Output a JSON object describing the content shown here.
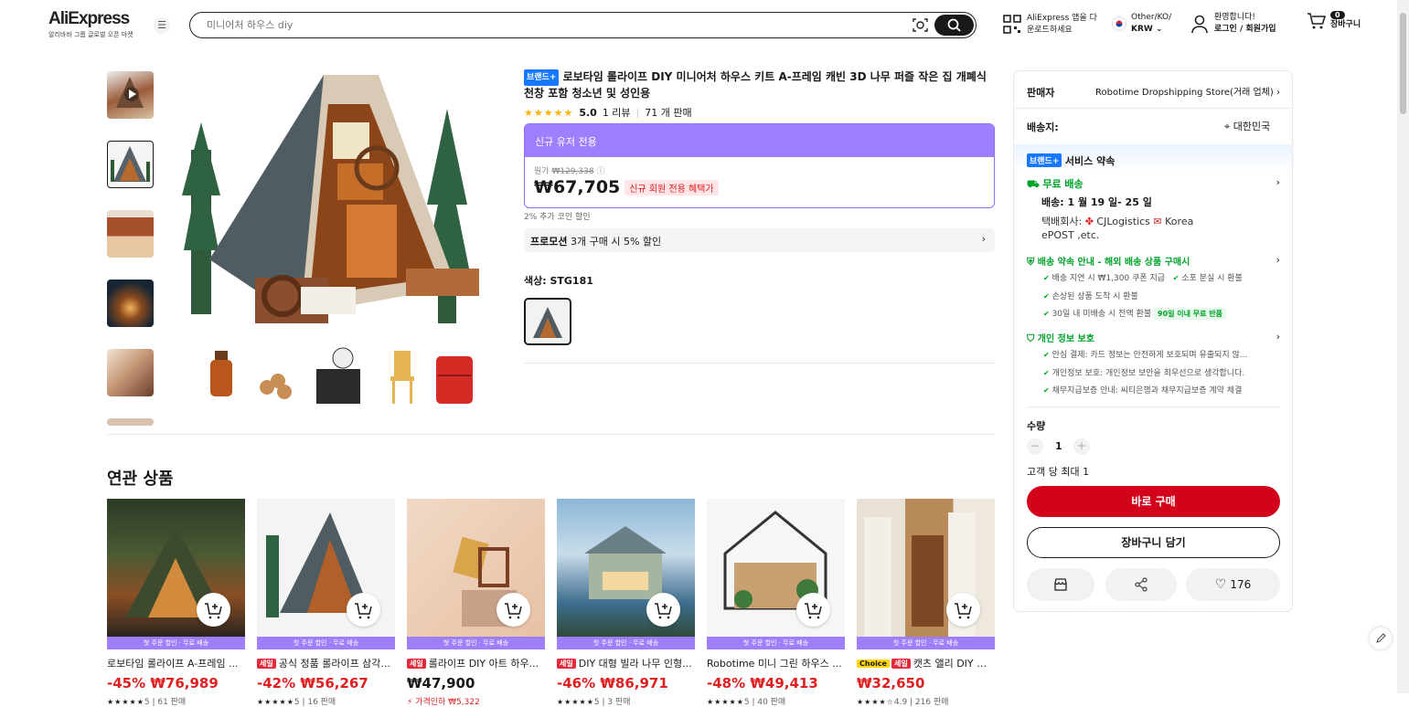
{
  "header": {
    "logo": "AliExpress",
    "logo_tagline": "알리바바 그룹 글로벌 오픈 마켓",
    "search_placeholder": "미니어처 하우스 diy",
    "app_line1": "AliExpress 앱을 다",
    "app_line2": "운로드하세요",
    "lang_line1": "Other/KO/",
    "lang_line2": "KRW",
    "user_line1": "환영합니다!",
    "user_line2": "로그인 / 회원가입",
    "cart_count": "0",
    "cart_label": "장바구니"
  },
  "product": {
    "brand_badge": "브랜드+",
    "title": "로보타임 롤라이프 DIY 미니어처 하우스 키트 A-프레임 캐빈 3D 나무 퍼즐 작은 집 개폐식 천창 포함 청소년 및 성인용",
    "rating": "5.0",
    "reviews": "1 리뷰",
    "sold": "71 개 판매",
    "price_header": "신규 유저 전용",
    "orig_label": "원가",
    "orig_price": "₩129,338",
    "price": "₩67,705",
    "price_badge": "신규 회원 전용 혜택가",
    "coin_note": "2% 추가 코인 할인",
    "promo_label": "프로모션",
    "promo_text": "3개 구매 시 5% 할인",
    "color_label": "색상: STG181"
  },
  "related": {
    "heading": "연관 상품",
    "strip": "첫 주문 할인 · 무료 배송",
    "items": [
      {
        "title": "로보타임 롤라이프 A-프레임 ...",
        "badge": "",
        "choice": "",
        "discount": "-45%",
        "price": "₩76,989",
        "meta": "5 | 61 판매"
      },
      {
        "title": "공식 정품 롤라이프 삼각...",
        "badge": "세일",
        "choice": "",
        "discount": "-42%",
        "price": "₩56,267",
        "meta": "5 | 16 판매"
      },
      {
        "title": "롤라이프 DIY 아트 하우...",
        "badge": "세일",
        "choice": "",
        "discount": "",
        "price": "₩47,900",
        "meta": "가격인하 ₩5,322"
      },
      {
        "title": "DIY 대형 빌라 나무 인형...",
        "badge": "세일",
        "choice": "",
        "discount": "-46%",
        "price": "₩86,971",
        "meta": "5 | 3 판매"
      },
      {
        "title": "Robotime 미니 그린 하우스 ...",
        "badge": "",
        "choice": "",
        "discount": "-48%",
        "price": "₩49,413",
        "meta": "5 | 40 판매"
      },
      {
        "title": "캣츠 앨리 DIY 미...",
        "badge": "세일",
        "choice": "Choice",
        "discount": "",
        "price": "₩32,650",
        "meta": "4.9 | 216 판매"
      }
    ]
  },
  "sidebar": {
    "seller_label": "판매자",
    "seller_name": "Robotime Dropshipping Store(거래 업체)",
    "ship_label": "배송지:",
    "ship_to": "대한민국",
    "brand_badge": "브랜드+",
    "service_title": "서비스 약속",
    "free_ship": "무료 배송",
    "delivery": "배송: 1 월 19 일- 25 일",
    "courier": "택배회사:",
    "courier1": "CJLogistics",
    "courier2": "Korea",
    "courier3": "ePOST ,etc.",
    "promise_title": "배송 약속 안내 - 해외 배송 상품 구매시",
    "p1": "배송 지연 시 ₩1,300 쿠폰 지급",
    "p2": "소포 분실 시 환불",
    "p3": "손상된 상품 도착 시 환불",
    "p4": "30일 내 미배송 시 전액 환불",
    "p4_pill": "90일 이내 무료 반품",
    "privacy_title": "개인 정보 보호",
    "s1": "안심 결제: 카드 정보는 안전하게 보호되며 유출되지 않...",
    "s2": "개인정보 보호: 개인정보 보안을 최우선으로 생각합니다.",
    "s3": "채무지급보증 안내: 씨티은행과 채무지급보증 계약 체결",
    "qty_label": "수량",
    "qty": "1",
    "qty_limit": "고객 당 최대 1",
    "buy_now": "바로 구매",
    "add_cart": "장바구니 담기",
    "wish_count": "176"
  },
  "colors": {
    "accent": "#d3031c",
    "promo": "#9d7fff",
    "green": "#00a32a",
    "brand": "#1677ff"
  }
}
